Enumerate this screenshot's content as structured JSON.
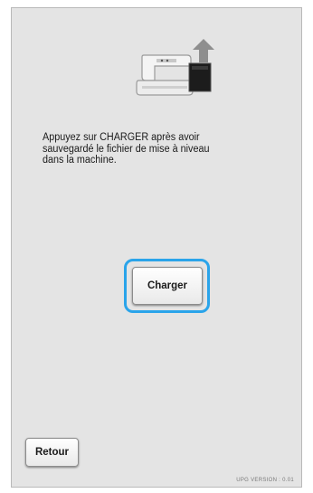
{
  "screen": {
    "background": "#e4e4e4",
    "icon": "sewing-machine-upgrade-icon",
    "message": "Appuyez sur CHARGER après avoir\nsauvegardé le fichier de mise à niveau\ndans la machine.",
    "charger_label": "Charger",
    "retour_label": "Retour",
    "version_text": "UPG VERSION : 0.01",
    "highlight_color": "#2aa4ea"
  }
}
